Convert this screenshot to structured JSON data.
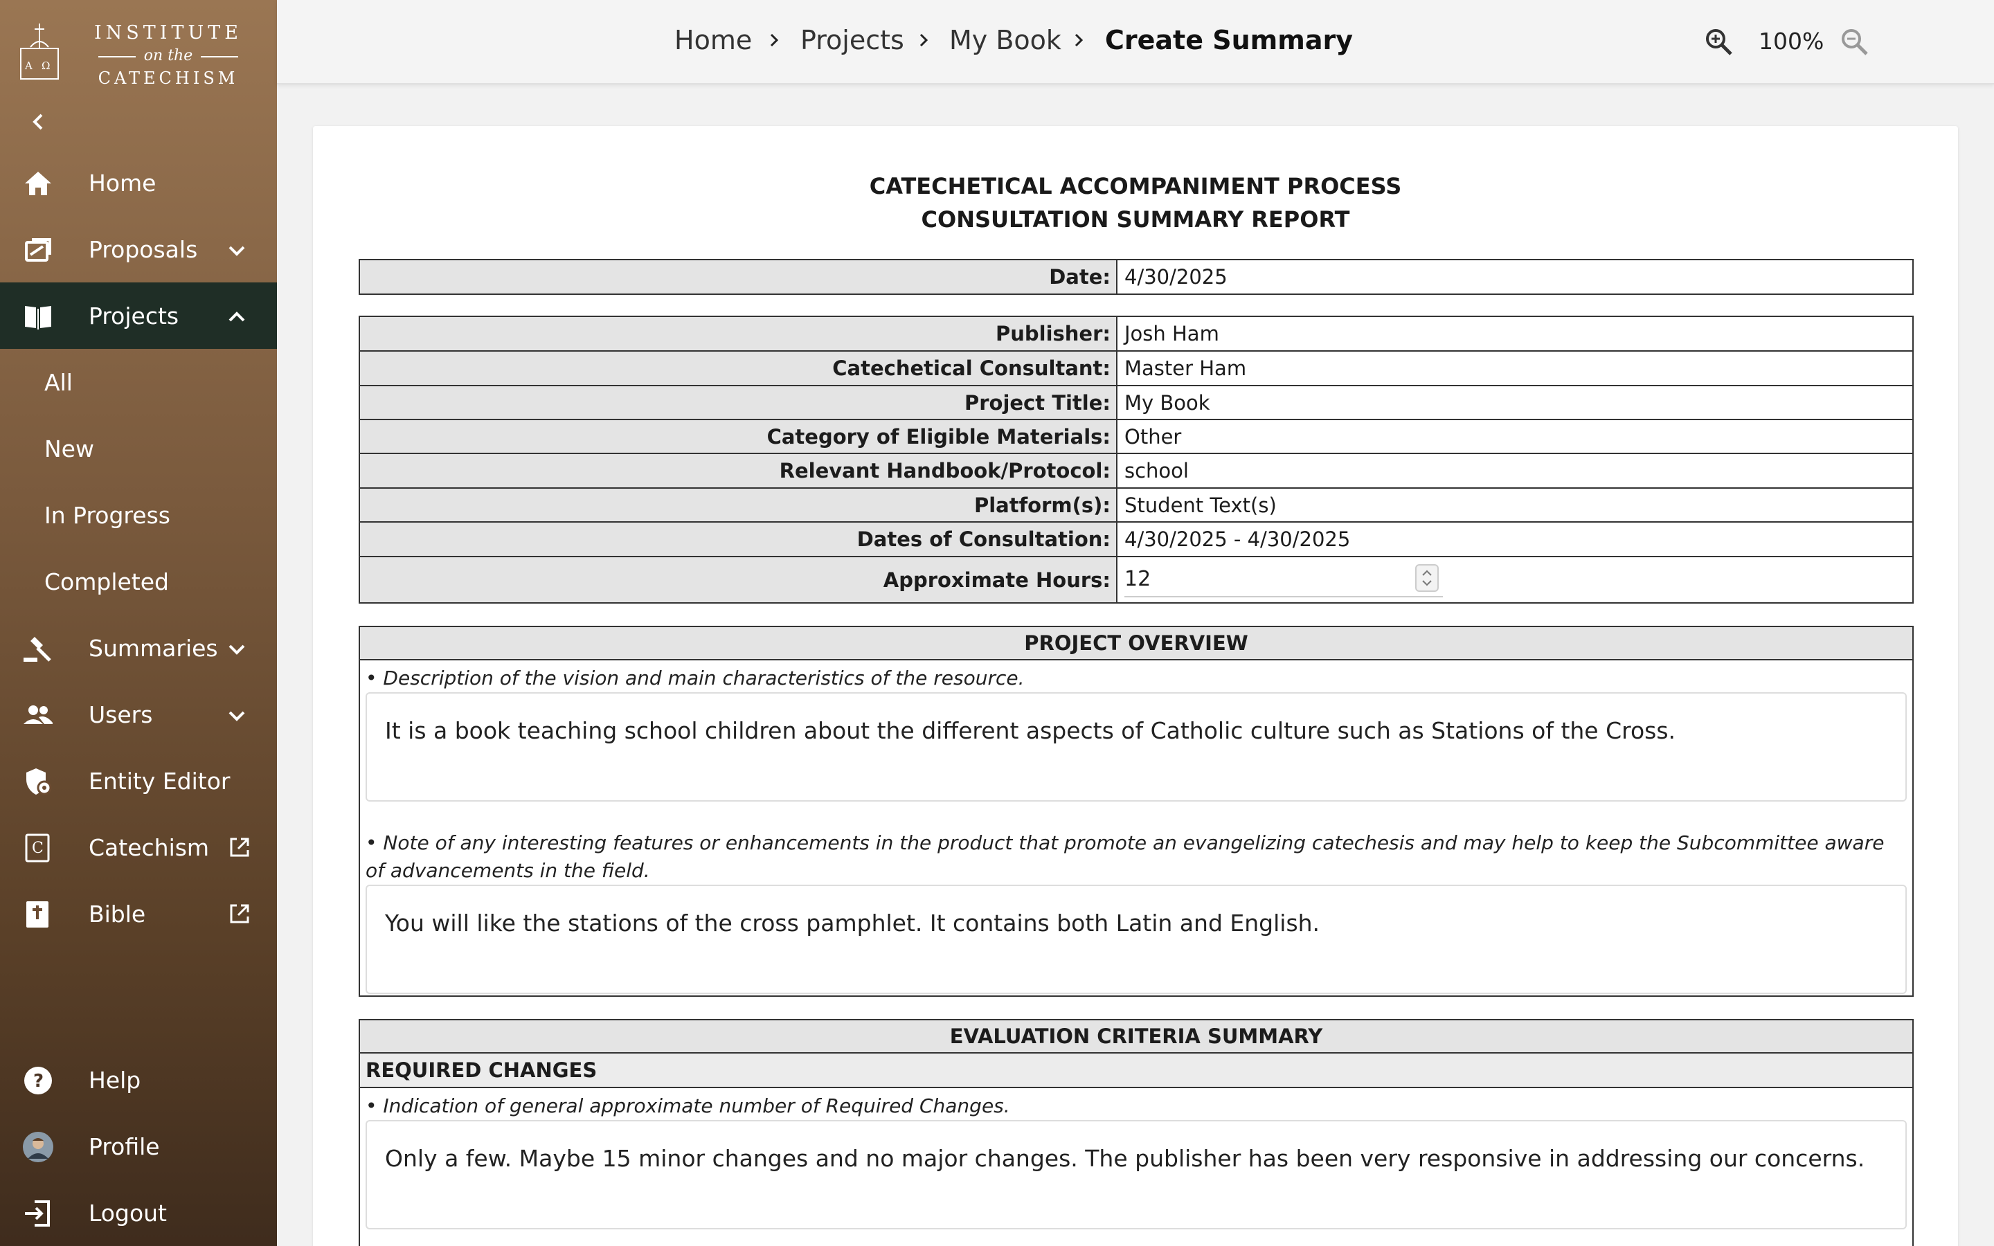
{
  "brand": {
    "line1": "INSTITUTE",
    "line2": "on the",
    "line3": "CATECHISM",
    "seal_letters": "A Ω"
  },
  "sidebar": {
    "items": [
      {
        "label": "Home",
        "icon": "home-icon"
      },
      {
        "label": "Proposals",
        "icon": "proposals-icon"
      },
      {
        "label": "Projects",
        "icon": "book-icon",
        "active": true
      },
      {
        "label": "Summaries",
        "icon": "gavel-icon"
      },
      {
        "label": "Users",
        "icon": "users-icon"
      },
      {
        "label": "Entity Editor",
        "icon": "shield-icon"
      },
      {
        "label": "Catechism",
        "icon": "catechism-icon"
      },
      {
        "label": "Bible",
        "icon": "bible-icon"
      }
    ],
    "project_subitems": [
      "All",
      "New",
      "In Progress",
      "Completed"
    ],
    "bottom": [
      {
        "label": "Help",
        "icon": "help-icon"
      },
      {
        "label": "Profile",
        "icon": "avatar"
      },
      {
        "label": "Logout",
        "icon": "logout-icon"
      }
    ]
  },
  "breadcrumb": [
    "Home",
    "Projects",
    "My Book",
    "Create Summary"
  ],
  "zoom": {
    "value": "100%"
  },
  "report": {
    "title_line1": "CATECHETICAL ACCOMPANIMENT PROCESS",
    "title_line2": "CONSULTATION SUMMARY REPORT",
    "date_label": "Date:",
    "date_value": "4/30/2025",
    "fields": [
      {
        "label": "Publisher:",
        "value": "Josh Ham"
      },
      {
        "label": "Catechetical Consultant:",
        "value": "Master Ham"
      },
      {
        "label": "Project Title:",
        "value": "My Book"
      },
      {
        "label": "Category of Eligible Materials:",
        "value": "Other"
      },
      {
        "label": "Relevant Handbook/Protocol:",
        "value": "school"
      },
      {
        "label": "Platform(s):",
        "value": "Student Text(s)"
      },
      {
        "label": "Dates of Consultation:",
        "value": "4/30/2025 - 4/30/2025"
      },
      {
        "label": "Approximate Hours:",
        "value": "12"
      }
    ],
    "overview": {
      "heading": "PROJECT OVERVIEW",
      "prompt1": "• Description of the vision and main characteristics of the resource.",
      "answer1": "It is a book teaching school children about the different aspects of Catholic culture such as Stations of the Cross.",
      "prompt2": "• Note of any interesting features or enhancements in the product that promote an evangelizing catechesis and may help to keep the Subcommittee aware of advancements in the field.",
      "answer2": "You will like the stations of the cross pamphlet. It contains both Latin and English."
    },
    "evaluation": {
      "heading": "EVALUATION CRITERIA SUMMARY",
      "subheading": "REQUIRED CHANGES",
      "prompt": "• Indication of general approximate number of Required Changes.",
      "answer": "Only a few. Maybe 15 minor changes and no major changes. The publisher has been very responsive in addressing our concerns."
    }
  }
}
